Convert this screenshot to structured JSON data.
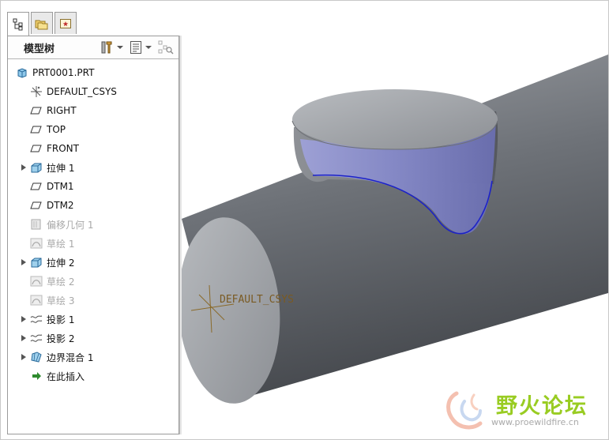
{
  "panel": {
    "title": "模型树"
  },
  "tree": {
    "root": "PRT0001.PRT",
    "items": [
      {
        "label": "DEFAULT_CSYS",
        "icon": "csys-icon",
        "expandable": false,
        "dimmed": false
      },
      {
        "label": "RIGHT",
        "icon": "datum-plane-icon",
        "expandable": false,
        "dimmed": false
      },
      {
        "label": "TOP",
        "icon": "datum-plane-icon",
        "expandable": false,
        "dimmed": false
      },
      {
        "label": "FRONT",
        "icon": "datum-plane-icon",
        "expandable": false,
        "dimmed": false
      },
      {
        "label": "拉伸 1",
        "icon": "extrude-icon",
        "expandable": true,
        "dimmed": false
      },
      {
        "label": "DTM1",
        "icon": "datum-plane-icon",
        "expandable": false,
        "dimmed": false
      },
      {
        "label": "DTM2",
        "icon": "datum-plane-icon",
        "expandable": false,
        "dimmed": false
      },
      {
        "label": "偏移几何 1",
        "icon": "offset-geometry-icon",
        "expandable": false,
        "dimmed": true
      },
      {
        "label": "草绘 1",
        "icon": "sketch-icon",
        "expandable": false,
        "dimmed": true
      },
      {
        "label": "拉伸 2",
        "icon": "extrude-icon",
        "expandable": true,
        "dimmed": false
      },
      {
        "label": "草绘 2",
        "icon": "sketch-icon",
        "expandable": false,
        "dimmed": true
      },
      {
        "label": "草绘 3",
        "icon": "sketch-icon",
        "expandable": false,
        "dimmed": true
      },
      {
        "label": "投影 1",
        "icon": "projection-icon",
        "expandable": true,
        "dimmed": false
      },
      {
        "label": "投影 2",
        "icon": "projection-icon",
        "expandable": true,
        "dimmed": false
      },
      {
        "label": "边界混合 1",
        "icon": "boundary-blend-icon",
        "expandable": true,
        "dimmed": false
      },
      {
        "label": "在此插入",
        "icon": "insert-here-icon",
        "expandable": false,
        "dimmed": false
      }
    ]
  },
  "viewport": {
    "csys_label": "DEFAULT_CSYS"
  },
  "watermark": {
    "text": "野火论坛",
    "url": "www.proewildfire.cn"
  },
  "colors": {
    "body": "#7d8288",
    "surface": "#8f92d2",
    "curve": "#1c22c8",
    "csys": "#8a6a2a",
    "watermark": "#99cc22"
  }
}
